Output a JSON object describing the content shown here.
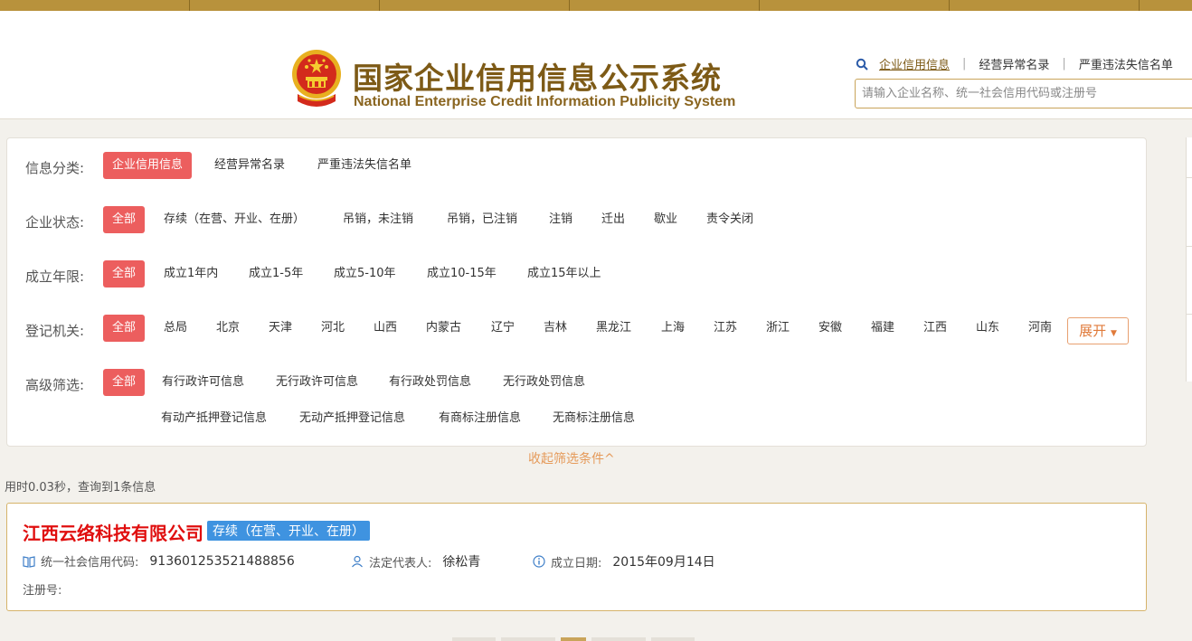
{
  "header": {
    "title_cn": "国家企业信用信息公示系统",
    "title_en": "National Enterprise Credit Information Publicity System",
    "nav": [
      "企业信用信息",
      "经营异常名录",
      "严重违法失信名单"
    ],
    "search_placeholder": "请输入企业名称、统一社会信用代码或注册号"
  },
  "filters": {
    "category": {
      "label": "信息分类:",
      "options": [
        "企业信用信息",
        "经营异常名录",
        "严重违法失信名单"
      ]
    },
    "status": {
      "label": "企业状态:",
      "options": [
        "全部",
        "存续（在营、开业、在册）",
        "吊销，未注销",
        "吊销，已注销",
        "注销",
        "迁出",
        "歇业",
        "责令关闭"
      ]
    },
    "age": {
      "label": "成立年限:",
      "options": [
        "全部",
        "成立1年内",
        "成立1-5年",
        "成立5-10年",
        "成立10-15年",
        "成立15年以上"
      ]
    },
    "authority": {
      "label": "登记机关:",
      "options": [
        "全部",
        "总局",
        "北京",
        "天津",
        "河北",
        "山西",
        "内蒙古",
        "辽宁",
        "吉林",
        "黑龙江",
        "上海",
        "江苏",
        "浙江",
        "安徽",
        "福建",
        "江西",
        "山东",
        "河南"
      ],
      "expand": "展开"
    },
    "advanced": {
      "label": "高级筛选:",
      "options": [
        "全部",
        "有行政许可信息",
        "无行政许可信息",
        "有行政处罚信息",
        "无行政处罚信息",
        "有动产抵押登记信息",
        "无动产抵押登记信息",
        "有商标注册信息",
        "无商标注册信息"
      ]
    },
    "collapse": "收起筛选条件^"
  },
  "stats": "用时0.03秒，查询到1条信息",
  "result": {
    "name": "江西云络科技有限公司",
    "status": "存续（在营、开业、在册）",
    "credit_label": "统一社会信用代码:",
    "credit_code": "913601253521488856",
    "rep_label": "法定代表人:",
    "rep": "徐松青",
    "date_label": "成立日期:",
    "date": "2015年09月14日",
    "reg_label": "注册号:"
  },
  "colors": {
    "accent": "#ec5e5e",
    "brand": "#7d5a16",
    "badge": "#3f93e0",
    "company": "#e00e0e"
  }
}
